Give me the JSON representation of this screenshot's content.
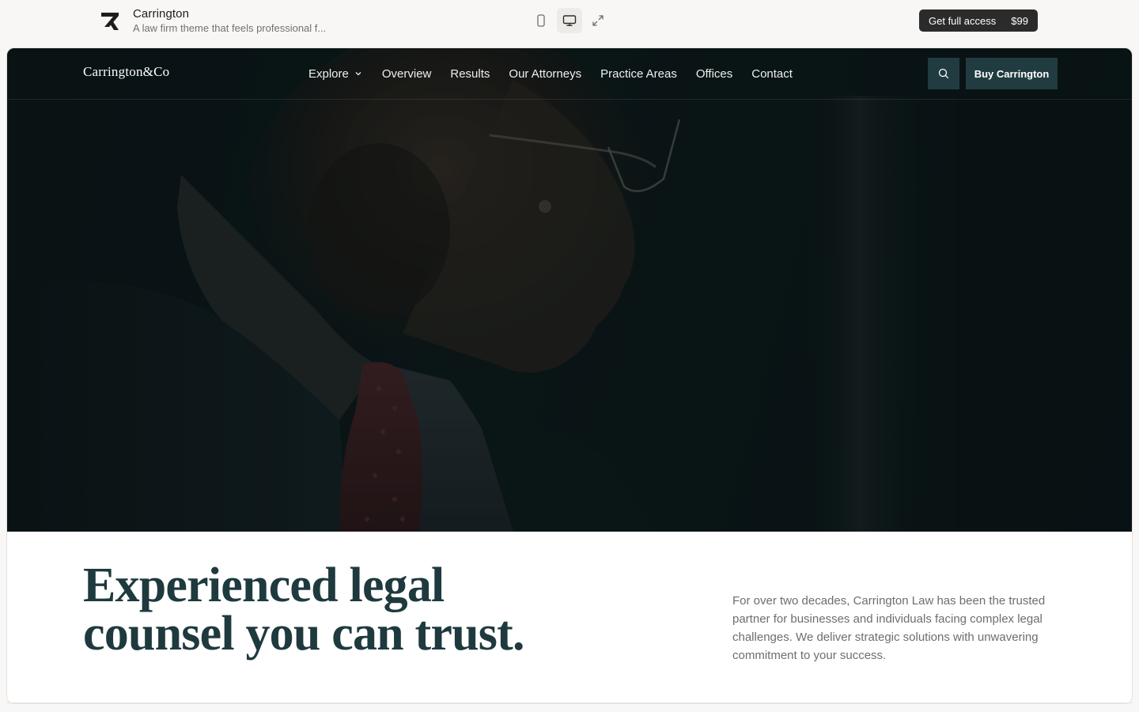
{
  "preview": {
    "title": "Carrington",
    "description": "A law firm theme that feels professional f...",
    "devices": [
      "mobile-icon",
      "desktop-icon",
      "expand-icon"
    ],
    "active_device": "desktop",
    "access_label": "Get full access",
    "price": "$99"
  },
  "site": {
    "logo": "Carrington&Co",
    "nav": [
      {
        "label": "Explore",
        "has_dropdown": true
      },
      {
        "label": "Overview"
      },
      {
        "label": "Results"
      },
      {
        "label": "Our Attorneys"
      },
      {
        "label": "Practice Areas"
      },
      {
        "label": "Offices"
      },
      {
        "label": "Contact"
      }
    ],
    "buy_label": "Buy Carrington",
    "accent_color": "#213c40"
  },
  "hero": {
    "image": "attorney-portrait-dark"
  },
  "intro": {
    "headline_line1": "Experienced legal",
    "headline_line2": "counsel you can trust.",
    "paragraph": "For over two decades, Carrington Law has been the trusted partner for businesses and individuals facing complex legal challenges. We deliver strategic solutions with unwavering commitment to your success."
  }
}
